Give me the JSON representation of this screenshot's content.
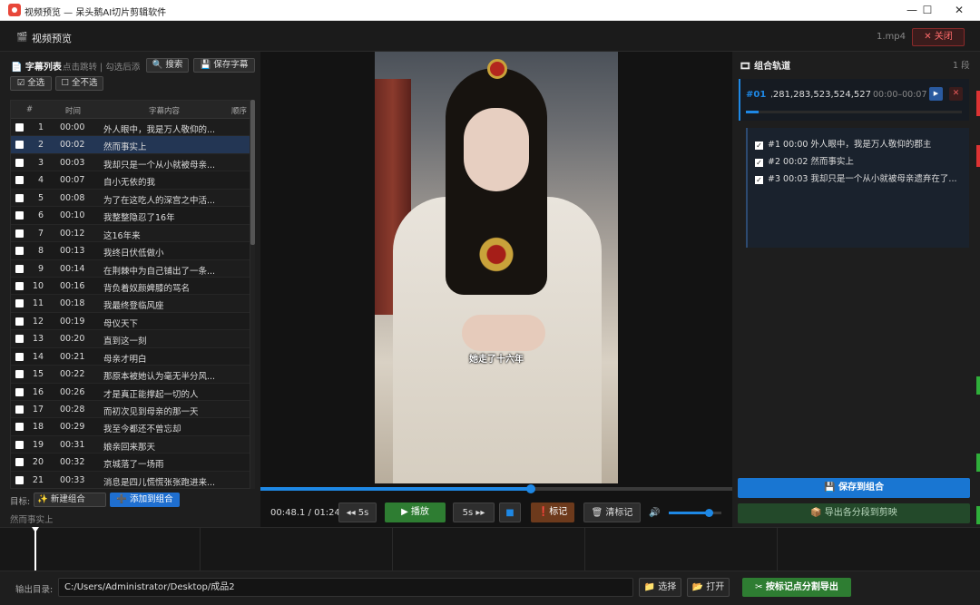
{
  "window": {
    "title": "视频预览 — 呆头鹅AI切片剪辑软件",
    "min_glyph": "—",
    "max_glyph": "☐",
    "close_glyph": "✕"
  },
  "header": {
    "icon": "🎬",
    "title": "视频预览",
    "filename": "1.mp4",
    "close_label": "✕ 关闭"
  },
  "subtitle_list": {
    "title": "📄 字幕列表",
    "hint": "点击跳转 | 勾选后添",
    "search_label": "🔍 搜索",
    "save_label": "💾 保存字幕",
    "select_all_label": "☑ 全选",
    "select_none_label": "☐ 全不选",
    "columns": [
      "#",
      "时间",
      "字幕内容",
      "顺序"
    ],
    "rows": [
      {
        "n": "1",
        "time": "00:00",
        "text": "外人眼中，我是万人敬仰的..."
      },
      {
        "n": "2",
        "time": "00:02",
        "text": "然而事实上"
      },
      {
        "n": "3",
        "time": "00:03",
        "text": "我却只是一个从小就被母亲..."
      },
      {
        "n": "4",
        "time": "00:07",
        "text": "自小无依的我"
      },
      {
        "n": "5",
        "time": "00:08",
        "text": "为了在这吃人的深宫之中活..."
      },
      {
        "n": "6",
        "time": "00:10",
        "text": "我整整隐忍了16年"
      },
      {
        "n": "7",
        "time": "00:12",
        "text": "这16年来"
      },
      {
        "n": "8",
        "time": "00:13",
        "text": "我终日伏低做小"
      },
      {
        "n": "9",
        "time": "00:14",
        "text": "在荆棘中为自己铺出了一条..."
      },
      {
        "n": "10",
        "time": "00:16",
        "text": "背负着奴颜婢膝的骂名"
      },
      {
        "n": "11",
        "time": "00:18",
        "text": "我最终登临风座"
      },
      {
        "n": "12",
        "time": "00:19",
        "text": "母仪天下"
      },
      {
        "n": "13",
        "time": "00:20",
        "text": "直到这一刻"
      },
      {
        "n": "14",
        "time": "00:21",
        "text": "母亲才明白"
      },
      {
        "n": "15",
        "time": "00:22",
        "text": "那原本被她认为毫无半分风..."
      },
      {
        "n": "16",
        "time": "00:26",
        "text": "才是真正能撑起一切的人"
      },
      {
        "n": "17",
        "time": "00:28",
        "text": "而初次见到母亲的那一天"
      },
      {
        "n": "18",
        "time": "00:29",
        "text": "我至今都还不曾忘却"
      },
      {
        "n": "19",
        "time": "00:31",
        "text": "娘亲回来那天"
      },
      {
        "n": "20",
        "time": "00:32",
        "text": "京城落了一场雨"
      },
      {
        "n": "21",
        "time": "00:33",
        "text": "消息是四儿慌慌张张跑进来..."
      }
    ],
    "target_label": "目标:",
    "new_group_label": "✨ 新建组合",
    "add_to_group_label": "➕ 添加到组合",
    "current_subtitle": "然而事实上"
  },
  "player": {
    "subtitle_overlay": "她走了十六年",
    "time": "00:48.1 / 01:24",
    "progress": 0.573,
    "volume": 0.75,
    "back_label": "◂◂ 5s",
    "play_label": "▶ 播放",
    "fwd_label": "5s ▸▸",
    "stop_label": "■",
    "mark_label": "❗标记",
    "clear_mark_label": "🗑 清标记",
    "volume_icon": "🔊"
  },
  "combo": {
    "title": "🎞 组合轨道",
    "count": "1 段",
    "group": {
      "id": "#01",
      "ids": "0,281,283,523,524,527",
      "range": "00:00–00:07",
      "play_glyph": "▶",
      "delete_glyph": "✕",
      "progress": 0.06
    },
    "items": [
      {
        "label": "#1  00:00  外人眼中，我是万人敬仰的郡主"
      },
      {
        "label": "#2  00:02  然而事实上"
      },
      {
        "label": "#3  00:03  我却只是一个从小就被母亲遗弃在了..."
      }
    ],
    "save_label": "💾 保存到组合",
    "export_label": "📦 导出各分段到剪映"
  },
  "bottom": {
    "output_label": "输出目录:",
    "output_path": "C:/Users/Administrator/Desktop/成品2",
    "choose_label": "📁 选择",
    "open_label": "📂 打开",
    "export_label": "✂ 按标记点分割导出"
  },
  "colors": {
    "accent": "#1e88e5",
    "danger": "#e85a5a",
    "success": "#2e7d32",
    "mark": "#6d3a1c"
  }
}
